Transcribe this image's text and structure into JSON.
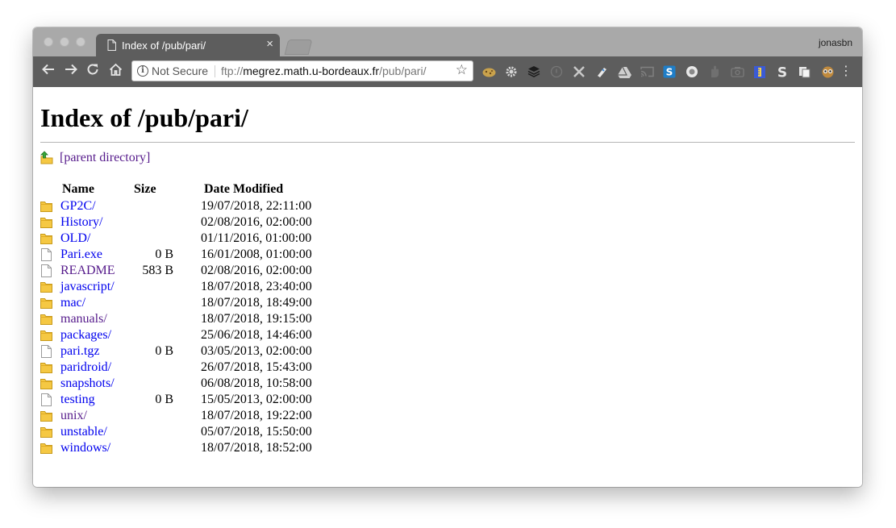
{
  "browser": {
    "tab_title": "Index of /pub/pari/",
    "tab_close": "×",
    "profile_name": "jonasbn",
    "security_label": "Not Secure",
    "url_scheme": "ftp://",
    "url_host": "megrez.math.u-bordeaux.fr",
    "url_path": "/pub/pari/",
    "extensions": [
      "cookie-icon",
      "gear-icon",
      "layers-icon",
      "circle-outline-icon",
      "wrench-icon",
      "tag-icon",
      "drive-icon",
      "cast-icon",
      "s-box-icon",
      "circle-icon",
      "hand-icon",
      "camera-icon",
      "ruler-icon",
      "s-large-icon",
      "pages-icon",
      "owl-icon"
    ]
  },
  "page": {
    "title": "Index of /pub/pari/",
    "parent_label": "[parent directory]",
    "headers": {
      "name": "Name",
      "size": "Size",
      "date": "Date Modified"
    },
    "link_color": "#0000ee",
    "visited_color": "#551a8b",
    "entries": [
      {
        "name": "GP2C/",
        "size": "",
        "date": "19/07/2018, 22:11:00",
        "type": "folder",
        "visited": false
      },
      {
        "name": "History/",
        "size": "",
        "date": "02/08/2016, 02:00:00",
        "type": "folder",
        "visited": false
      },
      {
        "name": "OLD/",
        "size": "",
        "date": "01/11/2016, 01:00:00",
        "type": "folder",
        "visited": false
      },
      {
        "name": "Pari.exe",
        "size": "0 B",
        "date": "16/01/2008, 01:00:00",
        "type": "file",
        "visited": false
      },
      {
        "name": "README",
        "size": "583 B",
        "date": "02/08/2016, 02:00:00",
        "type": "file",
        "visited": true
      },
      {
        "name": "javascript/",
        "size": "",
        "date": "18/07/2018, 23:40:00",
        "type": "folder",
        "visited": false
      },
      {
        "name": "mac/",
        "size": "",
        "date": "18/07/2018, 18:49:00",
        "type": "folder",
        "visited": false
      },
      {
        "name": "manuals/",
        "size": "",
        "date": "18/07/2018, 19:15:00",
        "type": "folder",
        "visited": true
      },
      {
        "name": "packages/",
        "size": "",
        "date": "25/06/2018, 14:46:00",
        "type": "folder",
        "visited": false
      },
      {
        "name": "pari.tgz",
        "size": "0 B",
        "date": "03/05/2013, 02:00:00",
        "type": "file",
        "visited": false
      },
      {
        "name": "paridroid/",
        "size": "",
        "date": "26/07/2018, 15:43:00",
        "type": "folder",
        "visited": false
      },
      {
        "name": "snapshots/",
        "size": "",
        "date": "06/08/2018, 10:58:00",
        "type": "folder",
        "visited": false
      },
      {
        "name": "testing",
        "size": "0 B",
        "date": "15/05/2013, 02:00:00",
        "type": "file",
        "visited": false
      },
      {
        "name": "unix/",
        "size": "",
        "date": "18/07/2018, 19:22:00",
        "type": "folder",
        "visited": true
      },
      {
        "name": "unstable/",
        "size": "",
        "date": "05/07/2018, 15:50:00",
        "type": "folder",
        "visited": false
      },
      {
        "name": "windows/",
        "size": "",
        "date": "18/07/2018, 18:52:00",
        "type": "folder",
        "visited": false
      }
    ]
  }
}
